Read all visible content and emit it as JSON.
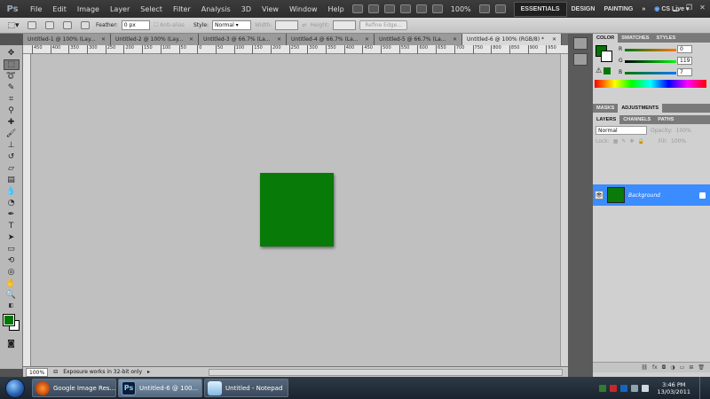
{
  "app": {
    "logo": "Ps"
  },
  "menus": [
    "File",
    "Edit",
    "Image",
    "Layer",
    "Select",
    "Filter",
    "Analysis",
    "3D",
    "View",
    "Window",
    "Help"
  ],
  "appbar": {
    "zoom": "100%",
    "workspaces": [
      "ESSENTIALS",
      "DESIGN",
      "PAINTING"
    ],
    "active_workspace": "ESSENTIALS",
    "cslive": "CS Live"
  },
  "options": {
    "feather_label": "Feather:",
    "feather_value": "0 px",
    "antialias_label": "Anti-alias",
    "style_label": "Style:",
    "style_value": "Normal",
    "width_label": "Width:",
    "height_label": "Height:",
    "refine_edge": "Refine Edge..."
  },
  "tabs": [
    {
      "label": "Untitled-1 @ 100% (Lay..."
    },
    {
      "label": "Untitled-2 @ 100% (Lay..."
    },
    {
      "label": "Untitled-3 @ 66.7% (La..."
    },
    {
      "label": "Untitled-4 @ 66.7% (La..."
    },
    {
      "label": "Untitled-5 @ 66.7% (La..."
    },
    {
      "label": "Untitled-6 @ 100% (RGB/8) *",
      "active": true
    }
  ],
  "ruler": {
    "top_ticks": [
      "450",
      "400",
      "350",
      "300",
      "250",
      "200",
      "150",
      "100",
      "50",
      "0",
      "50",
      "100",
      "150",
      "200",
      "250",
      "300",
      "350",
      "400",
      "450",
      "500",
      "550",
      "600",
      "650",
      "700",
      "750",
      "800",
      "850",
      "900",
      "950"
    ]
  },
  "canvas": {
    "bg_color": "#c0c0c0",
    "layer_color": "#077a07"
  },
  "status": {
    "zoom": "100%",
    "message": "Exposure works in 32-bit only"
  },
  "color_panel": {
    "tabs": [
      "COLOR",
      "SWATCHES",
      "STYLES"
    ],
    "fg_color": "#007700",
    "channels": [
      {
        "label": "R",
        "value": "0"
      },
      {
        "label": "G",
        "value": "119"
      },
      {
        "label": "B",
        "value": "7"
      }
    ]
  },
  "adjust_panel": {
    "tabs": [
      "MASKS",
      "ADJUSTMENTS"
    ]
  },
  "layers_panel": {
    "tabs": [
      "LAYERS",
      "CHANNELS",
      "PATHS"
    ],
    "blend_mode": "Normal",
    "opacity_label": "Opacity:",
    "opacity_value": "100%",
    "lock_label": "Lock:",
    "fill_label": "Fill:",
    "fill_value": "100%",
    "layer_name": "Background"
  },
  "taskbar": {
    "items": [
      {
        "label": "Google Image Res...",
        "icon": "firefox-icon"
      },
      {
        "label": "Untitled-6 @ 100...",
        "icon": "photoshop-icon",
        "active": true
      },
      {
        "label": "Untitled - Notepad",
        "icon": "notepad-icon"
      }
    ],
    "time": "3:46 PM",
    "date": "13/03/2011"
  }
}
